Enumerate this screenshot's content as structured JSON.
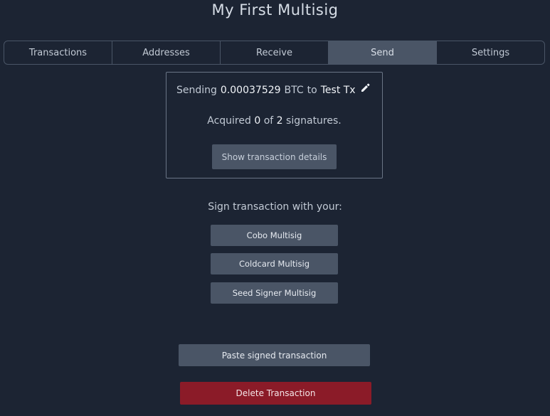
{
  "wallet": {
    "title": "My First Multisig"
  },
  "tabs": [
    {
      "label": "Transactions",
      "active": false
    },
    {
      "label": "Addresses",
      "active": false
    },
    {
      "label": "Receive",
      "active": false
    },
    {
      "label": "Send",
      "active": true
    },
    {
      "label": "Settings",
      "active": false
    }
  ],
  "transaction": {
    "sending_prefix": "Sending",
    "amount": "0.00037529",
    "unit": "BTC",
    "to_word": "to",
    "recipient": "Test Tx",
    "edit_icon": "pencil-icon",
    "acquired_prefix": "Acquired",
    "acquired_count": "0",
    "of_word": "of",
    "required_count": "2",
    "signatures_suffix": "signatures.",
    "details_button": "Show transaction details"
  },
  "signing": {
    "heading": "Sign transaction with your:",
    "devices": [
      {
        "label": "Cobo Multisig"
      },
      {
        "label": "Coldcard Multisig"
      },
      {
        "label": "Seed Signer Multisig"
      }
    ]
  },
  "actions": {
    "paste_label": "Paste signed transaction",
    "delete_label": "Delete Transaction"
  },
  "colors": {
    "background": "#1c2433",
    "button": "#4a5566",
    "danger": "#8b1b28"
  }
}
